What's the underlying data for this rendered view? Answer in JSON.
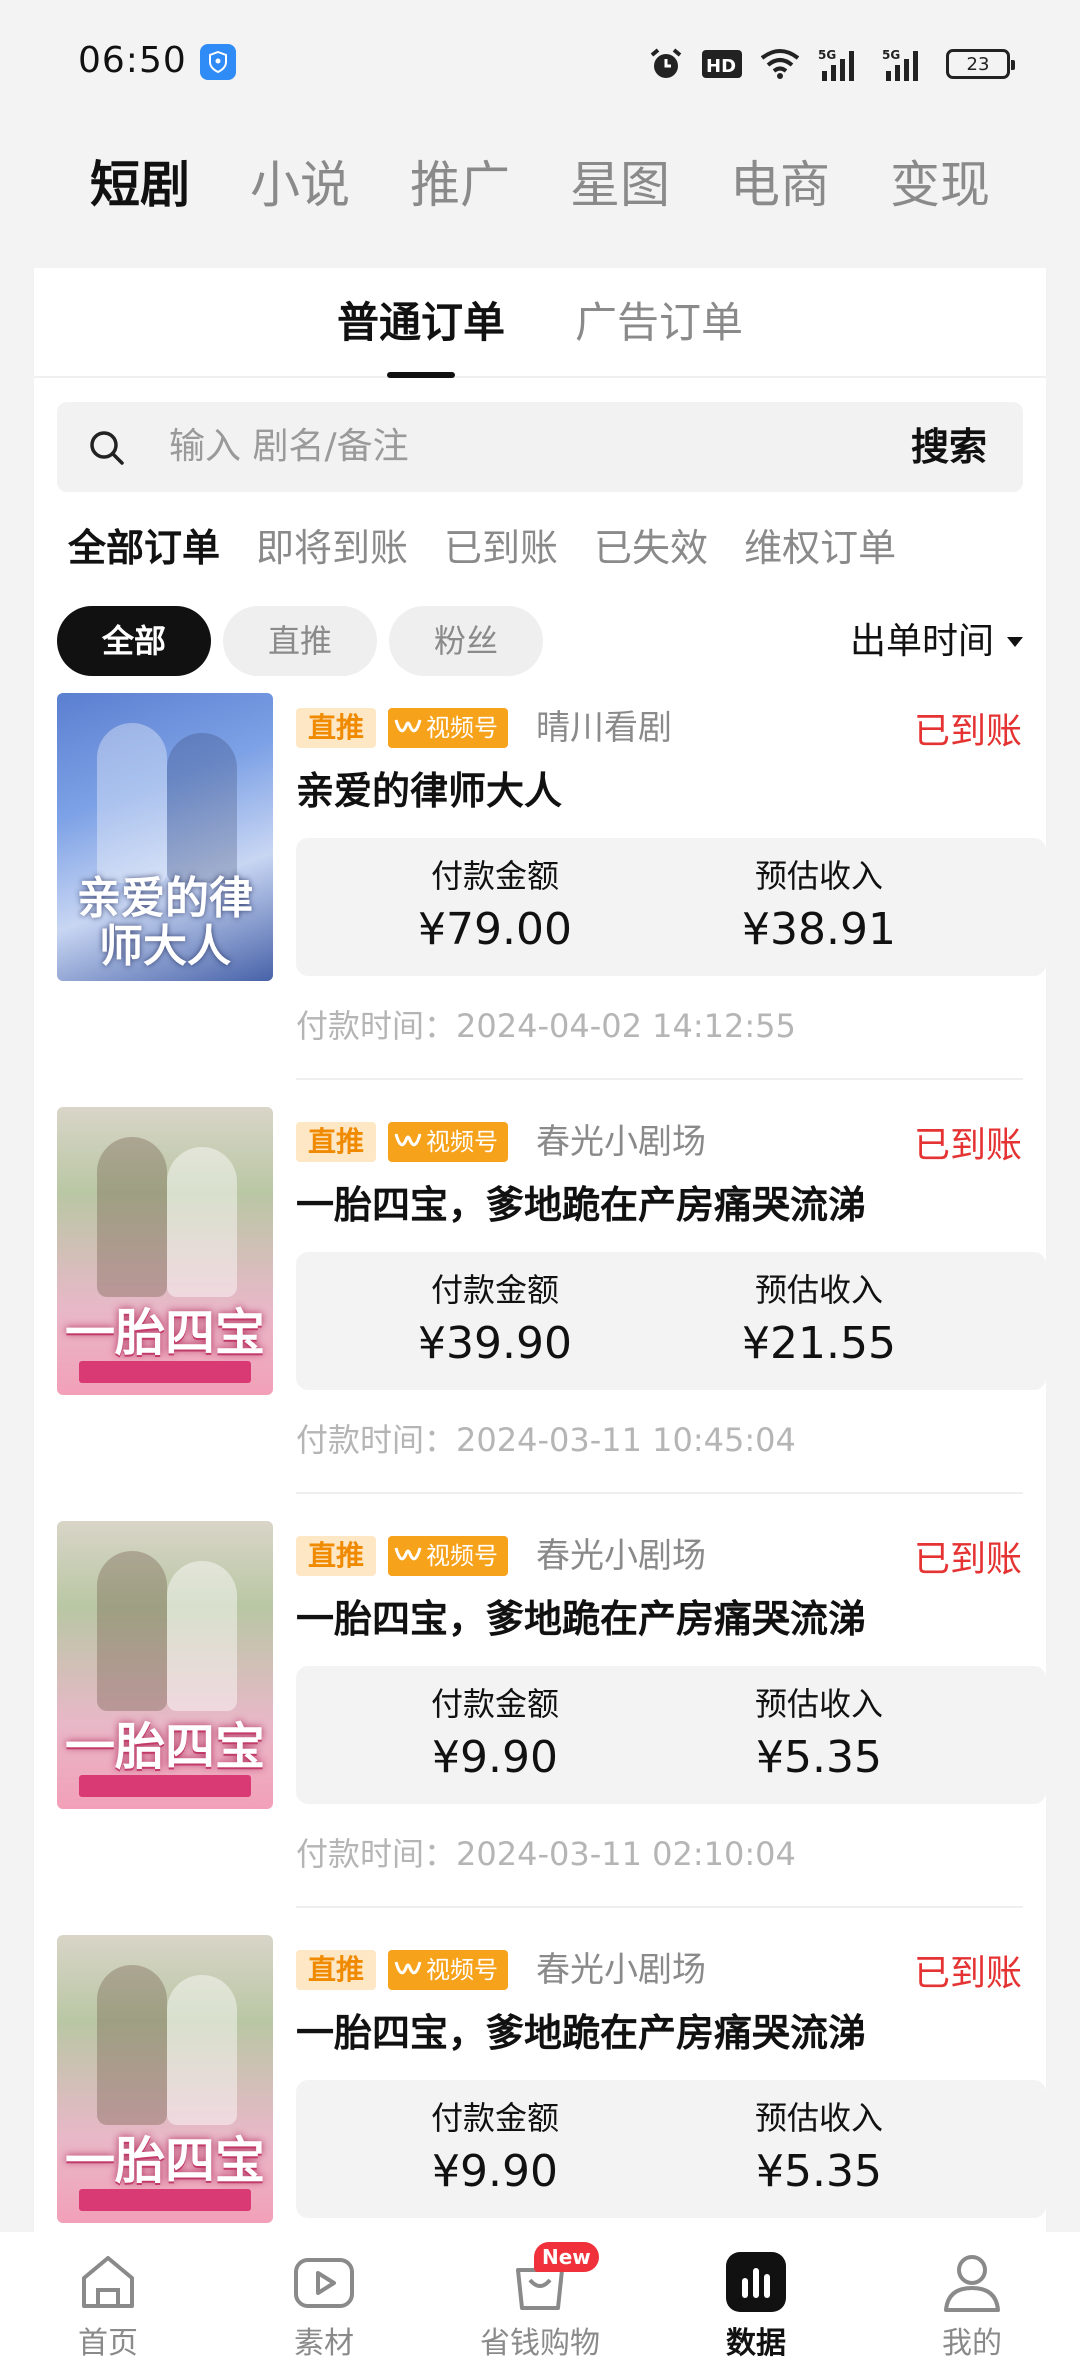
{
  "status_bar": {
    "time": "06:50",
    "battery": "23",
    "icons": [
      "shield-icon",
      "alarm-icon",
      "hd-icon",
      "wifi-icon",
      "5g-signal-icon",
      "5g-signal-icon",
      "battery-icon"
    ]
  },
  "top_tabs": [
    {
      "label": "短剧",
      "active": true
    },
    {
      "label": "小说",
      "active": false
    },
    {
      "label": "推广",
      "active": false
    },
    {
      "label": "星图",
      "active": false
    },
    {
      "label": "电商",
      "active": false
    },
    {
      "label": "变现",
      "active": false
    }
  ],
  "order_types": [
    {
      "label": "普通订单",
      "active": true
    },
    {
      "label": "广告订单",
      "active": false
    }
  ],
  "search": {
    "placeholder": "输入 剧名/备注",
    "button": "搜索"
  },
  "status_filters": [
    {
      "label": "全部订单",
      "active": true
    },
    {
      "label": "即将到账",
      "active": false
    },
    {
      "label": "已到账",
      "active": false
    },
    {
      "label": "已失效",
      "active": false
    },
    {
      "label": "维权订单",
      "active": false
    }
  ],
  "source_chips": [
    {
      "label": "全部",
      "active": true
    },
    {
      "label": "直推",
      "active": false
    },
    {
      "label": "粉丝",
      "active": false
    }
  ],
  "sort": {
    "label": "出单时间"
  },
  "labels": {
    "pay_amount": "付款金额",
    "est_income": "预估收入"
  },
  "orders": [
    {
      "tag": "直推",
      "platform": "视频号",
      "channel": "晴川看剧",
      "status": "已到账",
      "title": "亲爱的律师大人",
      "poster_text": "亲爱的律师大人",
      "amount": "¥79.00",
      "income": "¥38.91",
      "pay_time": "付款时间：2024-04-02 14:12:55"
    },
    {
      "tag": "直推",
      "platform": "视频号",
      "channel": "春光小剧场",
      "status": "已到账",
      "title": "一胎四宝，爹地跪在产房痛哭流涕",
      "poster_text": "一胎四宝",
      "amount": "¥39.90",
      "income": "¥21.55",
      "pay_time": "付款时间：2024-03-11 10:45:04"
    },
    {
      "tag": "直推",
      "platform": "视频号",
      "channel": "春光小剧场",
      "status": "已到账",
      "title": "一胎四宝，爹地跪在产房痛哭流涕",
      "poster_text": "一胎四宝",
      "amount": "¥9.90",
      "income": "¥5.35",
      "pay_time": "付款时间：2024-03-11 02:10:04"
    },
    {
      "tag": "直推",
      "platform": "视频号",
      "channel": "春光小剧场",
      "status": "已到账",
      "title": "一胎四宝，爹地跪在产房痛哭流涕",
      "poster_text": "一胎四宝",
      "amount": "¥9.90",
      "income": "¥5.35",
      "pay_time": ""
    }
  ],
  "bottom_nav": [
    {
      "label": "首页",
      "icon": "home-icon",
      "active": false
    },
    {
      "label": "素材",
      "icon": "play-icon",
      "active": false
    },
    {
      "label": "省钱购物",
      "icon": "shopping-bag-icon",
      "active": false,
      "badge": "New"
    },
    {
      "label": "数据",
      "icon": "bar-chart-icon",
      "active": true
    },
    {
      "label": "我的",
      "icon": "user-icon",
      "active": false
    }
  ],
  "colors": {
    "accent_red": "#e53232",
    "tag_orange": "#f08a00",
    "platform_orange": "#f7a21b",
    "badge_red": "#f0303a"
  }
}
